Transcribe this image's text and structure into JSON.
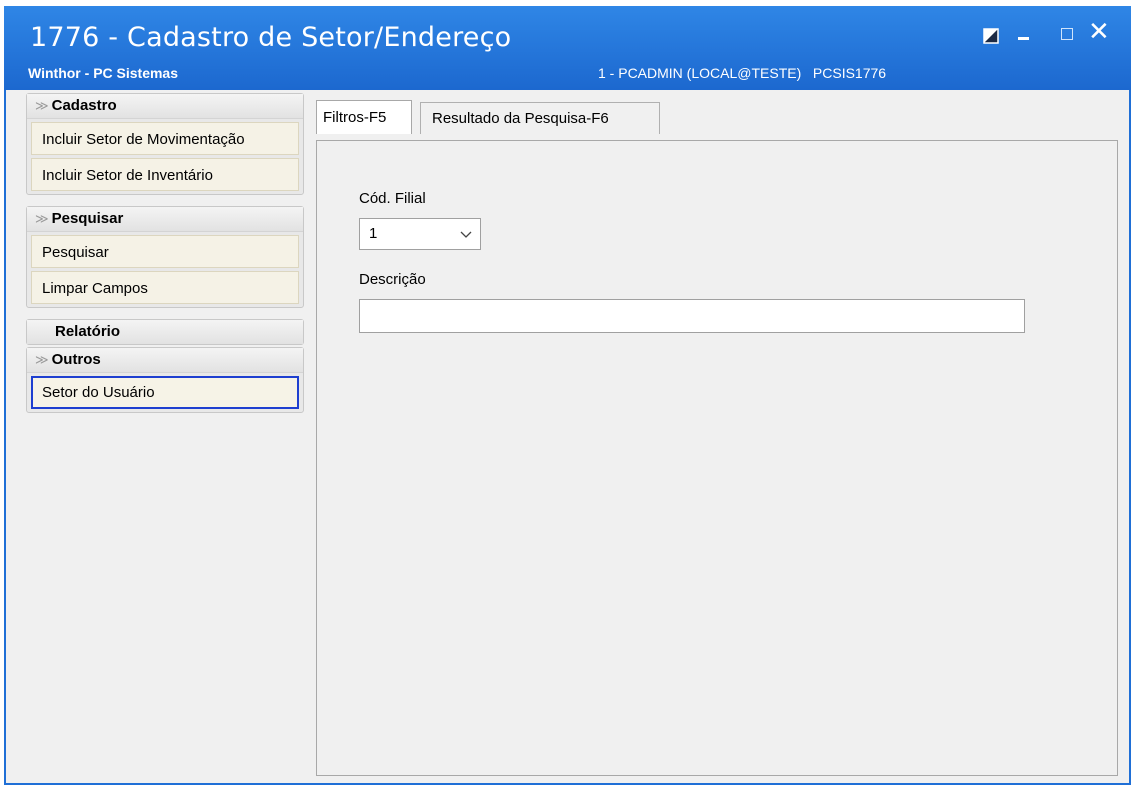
{
  "window": {
    "title": "1776 - Cadastro de Setor/Endereço",
    "subtitle": "Winthor - PC Sistemas",
    "user_info": "1 - PCADMIN (LOCAL@TESTE)   PCSIS1776",
    "controls": [
      "restore-icon",
      "minimize-icon",
      "maximize-icon",
      "close-icon"
    ],
    "close_glyph": "✕"
  },
  "sidebar": {
    "groups": [
      {
        "title": "Cadastro",
        "items": [
          {
            "label": "Incluir Setor de Movimentação"
          },
          {
            "label": "Incluir Setor de Inventário"
          }
        ]
      },
      {
        "title": "Pesquisar",
        "items": [
          {
            "label": "Pesquisar"
          },
          {
            "label": "Limpar Campos"
          }
        ]
      },
      {
        "title": "Relatório",
        "items": []
      },
      {
        "title": "Outros",
        "items": [
          {
            "label": "Setor do Usuário",
            "selected": true
          }
        ]
      }
    ]
  },
  "tabs": [
    {
      "label": "Filtros-F5",
      "active": true
    },
    {
      "label": "Resultado da Pesquisa-F6",
      "active": false
    }
  ],
  "filters": {
    "cod_filial_label": "Cód. Filial",
    "cod_filial_value": "1",
    "descricao_label": "Descrição",
    "descricao_value": ""
  },
  "colors": {
    "titlebar": "#1f6fd6",
    "selected_border": "#1e3fd0",
    "item_bg": "#f5f2e6"
  }
}
